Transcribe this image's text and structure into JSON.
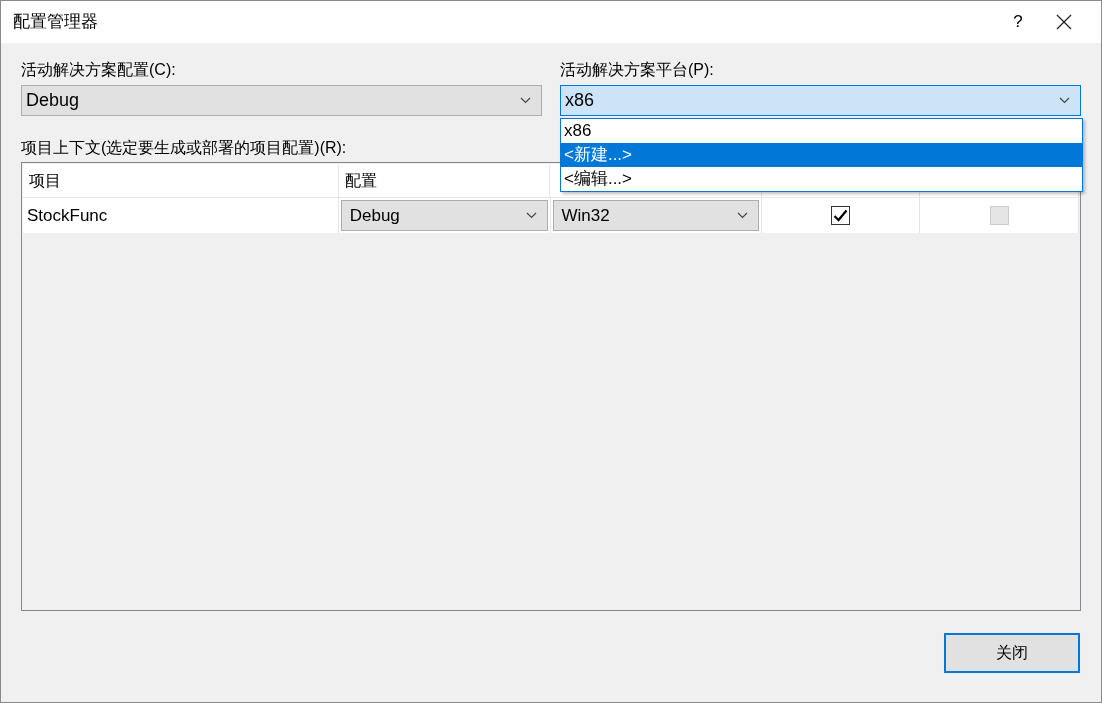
{
  "window": {
    "title": "配置管理器",
    "help": "?"
  },
  "active_config": {
    "label": "活动解决方案配置(C):",
    "value": "Debug"
  },
  "active_platform": {
    "label": "活动解决方案平台(P):",
    "value": "x86",
    "expanded": true,
    "options": [
      {
        "label": "x86",
        "highlighted": false
      },
      {
        "label": "<新建...>",
        "highlighted": true
      },
      {
        "label": "<编辑...>",
        "highlighted": false
      }
    ]
  },
  "project_context": {
    "label": "项目上下文(选定要生成或部署的项目配置)(R):",
    "columns": [
      "项目",
      "配置",
      null,
      null,
      null
    ],
    "rows": [
      {
        "project": "StockFunc",
        "configuration": "Debug",
        "platform": "Win32",
        "build": true,
        "build_disabled": false,
        "deploy": false,
        "deploy_disabled": true
      }
    ]
  },
  "buttons": [
    {
      "label": "关闭"
    }
  ]
}
